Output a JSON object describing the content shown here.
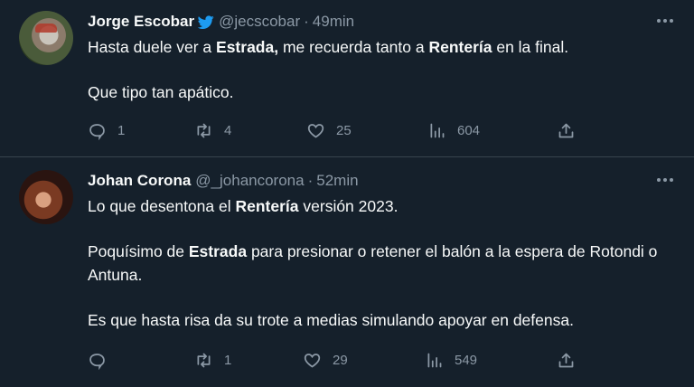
{
  "tweets": [
    {
      "name": "Jorge Escobar",
      "verified": true,
      "handle": "@jecscobar",
      "time": "49min",
      "paragraphs": [
        [
          {
            "t": "Hasta duele ver a ",
            "b": false
          },
          {
            "t": "Estrada,",
            "b": true
          },
          {
            "t": " me recuerda tanto a ",
            "b": false
          },
          {
            "t": "Rentería",
            "b": true
          },
          {
            "t": " en la final.",
            "b": false
          }
        ],
        [
          {
            "t": "Que tipo tan apático.",
            "b": false
          }
        ]
      ],
      "actions": {
        "reply": "1",
        "retweet": "4",
        "like": "25",
        "views": "604"
      }
    },
    {
      "name": "Johan Corona",
      "verified": false,
      "handle": "@_johancorona",
      "time": "52min",
      "paragraphs": [
        [
          {
            "t": "Lo que desentona el ",
            "b": false
          },
          {
            "t": "Rentería",
            "b": true
          },
          {
            "t": " versión 2023.",
            "b": false
          }
        ],
        [
          {
            "t": "Poquísimo de ",
            "b": false
          },
          {
            "t": "Estrada",
            "b": true
          },
          {
            "t": " para presionar o retener el balón a la espera de Rotondi o Antuna.",
            "b": false
          }
        ],
        [
          {
            "t": "Es que hasta risa da su trote a medias simulando apoyar en defensa.",
            "b": false
          }
        ]
      ],
      "actions": {
        "reply": "",
        "retweet": "1",
        "like": "29",
        "views": "549"
      }
    }
  ],
  "dot": "·",
  "colors": {
    "background": "#15202b",
    "muted": "#8b98a5",
    "verified": "#1d9bf0"
  }
}
